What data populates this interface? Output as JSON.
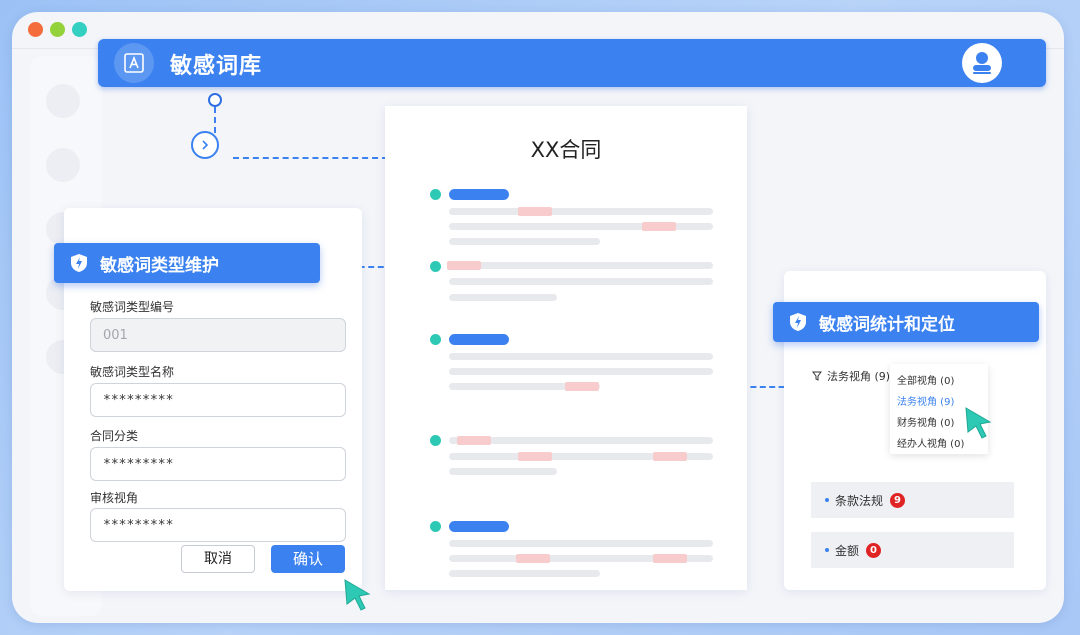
{
  "window": {
    "controls": [
      "close",
      "minimize",
      "maximize"
    ]
  },
  "header": {
    "title": "敏感词库",
    "logo_icon": "font-a-icon",
    "avatar_icon": "user-avatar-icon",
    "accent": "#3b82f0"
  },
  "document": {
    "title": "XX合同",
    "paragraph_bullet_color": "#2ec9b4",
    "highlight_color": "#f8cccc"
  },
  "form": {
    "title": "敏感词类型维护",
    "fields": [
      {
        "label": "敏感词类型编号",
        "value": "",
        "placeholder": "001"
      },
      {
        "label": "敏感词类型名称",
        "value": "*********"
      },
      {
        "label": "合同分类",
        "value": "*********"
      },
      {
        "label": "审核视角",
        "value": "*********"
      }
    ],
    "cancel_label": "取消",
    "confirm_label": "确认"
  },
  "stats": {
    "title": "敏感词统计和定位",
    "filter_label": "法务视角 (9)",
    "dropdown": [
      {
        "label": "全部视角 (0)",
        "active": false
      },
      {
        "label": "法务视角 (9)",
        "active": true
      },
      {
        "label": "财务视角 (0)",
        "active": false
      },
      {
        "label": "经办人视角 (0)",
        "active": false
      }
    ],
    "items": [
      {
        "label": "条款法规",
        "count": "9"
      },
      {
        "label": "金额",
        "count": "0"
      }
    ],
    "badge_color": "#e02424"
  }
}
